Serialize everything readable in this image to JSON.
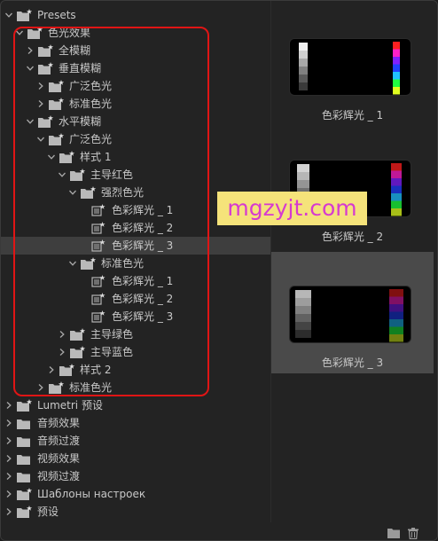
{
  "tree": [
    {
      "label": "Presets",
      "level": 0,
      "expanded": true,
      "icon": "folder-star-icon"
    },
    {
      "label": "色光效果",
      "level": 1,
      "expanded": true,
      "icon": "folder-star-icon"
    },
    {
      "label": "全模糊",
      "level": 2,
      "expanded": false,
      "icon": "folder-star-icon"
    },
    {
      "label": "垂直模糊",
      "level": 2,
      "expanded": true,
      "icon": "folder-star-icon"
    },
    {
      "label": "广泛色光",
      "level": 3,
      "expanded": false,
      "icon": "folder-star-icon"
    },
    {
      "label": "标准色光",
      "level": 3,
      "expanded": false,
      "icon": "folder-star-icon"
    },
    {
      "label": "水平模糊",
      "level": 2,
      "expanded": true,
      "icon": "folder-star-icon"
    },
    {
      "label": "广泛色光",
      "level": 3,
      "expanded": true,
      "icon": "folder-star-icon"
    },
    {
      "label": "样式 1",
      "level": 4,
      "expanded": true,
      "icon": "folder-star-icon"
    },
    {
      "label": "主导红色",
      "level": 5,
      "expanded": true,
      "icon": "folder-star-icon"
    },
    {
      "label": "强烈色光",
      "level": 6,
      "expanded": true,
      "icon": "folder-star-icon"
    },
    {
      "label": "色彩辉光 _ 1",
      "level": 7,
      "expanded": null,
      "icon": "preset-icon"
    },
    {
      "label": "色彩辉光 _ 2",
      "level": 7,
      "expanded": null,
      "icon": "preset-icon"
    },
    {
      "label": "色彩辉光 _ 3",
      "level": 7,
      "expanded": null,
      "icon": "preset-icon",
      "selected": true
    },
    {
      "label": "标准色光",
      "level": 6,
      "expanded": true,
      "icon": "folder-star-icon"
    },
    {
      "label": "色彩辉光 _ 1",
      "level": 7,
      "expanded": null,
      "icon": "preset-icon"
    },
    {
      "label": "色彩辉光 _ 2",
      "level": 7,
      "expanded": null,
      "icon": "preset-icon"
    },
    {
      "label": "色彩辉光 _ 3",
      "level": 7,
      "expanded": null,
      "icon": "preset-icon"
    },
    {
      "label": "主导绿色",
      "level": 5,
      "expanded": false,
      "icon": "folder-star-icon"
    },
    {
      "label": "主导蓝色",
      "level": 5,
      "expanded": false,
      "icon": "folder-star-icon"
    },
    {
      "label": "样式 2",
      "level": 4,
      "expanded": false,
      "icon": "folder-star-icon"
    },
    {
      "label": "标准色光",
      "level": 3,
      "expanded": false,
      "icon": "folder-star-icon"
    },
    {
      "label": "Lumetri 预设",
      "level": 0,
      "expanded": false,
      "icon": "folder-star-icon"
    },
    {
      "label": "音频效果",
      "level": 0,
      "expanded": false,
      "icon": "folder-icon"
    },
    {
      "label": "音频过渡",
      "level": 0,
      "expanded": false,
      "icon": "folder-icon"
    },
    {
      "label": "视频效果",
      "level": 0,
      "expanded": false,
      "icon": "folder-icon"
    },
    {
      "label": "视频过渡",
      "level": 0,
      "expanded": false,
      "icon": "folder-icon"
    },
    {
      "label": "Шаблоны настроек",
      "level": 0,
      "expanded": false,
      "icon": "folder-star-icon"
    },
    {
      "label": "预设",
      "level": 0,
      "expanded": false,
      "icon": "folder-star-icon"
    }
  ],
  "previews": [
    {
      "caption": "色彩辉光 _ 1",
      "selected": false
    },
    {
      "caption": "色彩辉光 _ 2",
      "selected": false
    },
    {
      "caption": "色彩辉光 _ 3",
      "selected": true
    }
  ],
  "watermark": "mgzyjt.com",
  "bottom_bar": {
    "icons": [
      "new-bin-icon",
      "delete-icon"
    ]
  },
  "colors": {
    "highlight_box": "#e01515",
    "watermark_bg": "#f5e37a",
    "watermark_text": "#d63ad0",
    "selected_row": "#3e3e3e"
  }
}
